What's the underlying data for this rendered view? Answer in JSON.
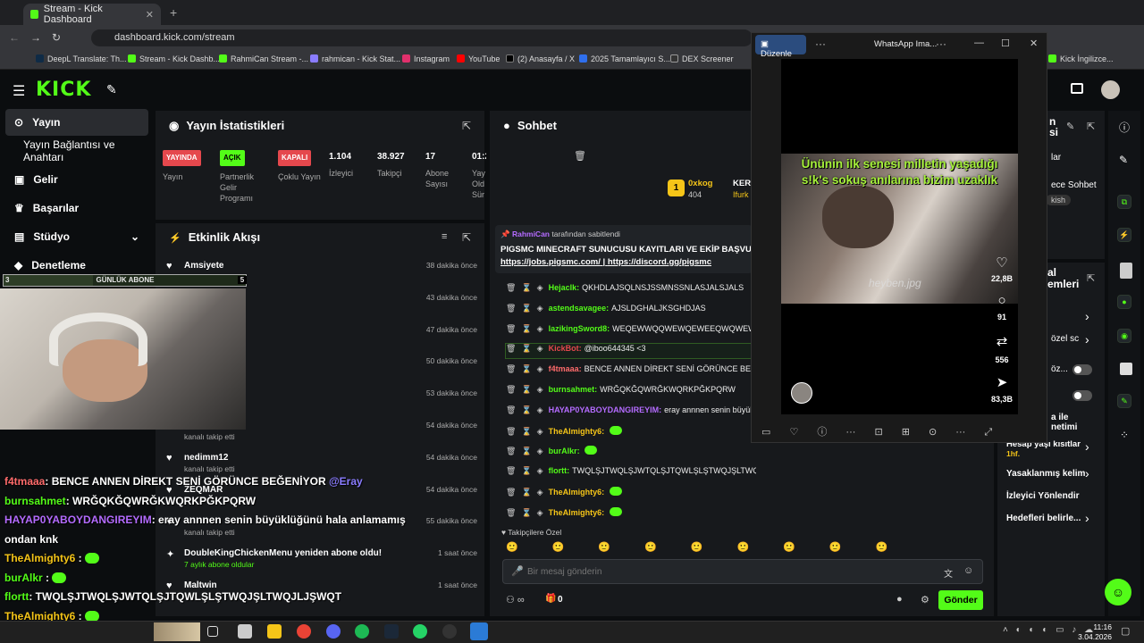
{
  "browser": {
    "tab_title": "Stream - Kick Dashboard",
    "url": "dashboard.kick.com/stream",
    "bookmarks": [
      "DeepL Translate: Th...",
      "Stream - Kick Dashb...",
      "RahmiCan Stream -...",
      "rahmican - Kick Stat...",
      "Instagram",
      "YouTube",
      "(2) Anasayfa / X",
      "2025 Tamamlayıcı S...",
      "DEX Screener",
      "Kick İngilizce..."
    ]
  },
  "sidebar": {
    "items": [
      "Yayın",
      "Yayın Bağlantısı ve Anahtarı",
      "Gelir",
      "Başarılar",
      "Stüdyo",
      "Denetleme"
    ]
  },
  "stats": {
    "title": "Yayın İstatistikleri",
    "status": [
      {
        "badge": "YAYINDA",
        "label": "Yayın"
      },
      {
        "badge": "AÇIK",
        "label": "Partnerlik Gelir Programı"
      },
      {
        "badge": "KAPALI",
        "label": "Çoklu Yayın"
      }
    ],
    "numbers": [
      {
        "value": "1.104",
        "label": "İzleyici"
      },
      {
        "value": "38.927",
        "label": "Takipçi"
      },
      {
        "value": "17",
        "label": "Abone Sayısı"
      },
      {
        "value": "01:2",
        "label": "Yay Old Sür"
      }
    ]
  },
  "activity": {
    "title": "Etkinlik Akışı",
    "events": [
      {
        "name": "Amsiyete",
        "sub": "kanalı takip etti",
        "time": "38 dakika önce",
        "icon": "heart"
      },
      {
        "name": "",
        "sub": "",
        "time": "43 dakika önce",
        "icon": "heart"
      },
      {
        "name": "",
        "sub": "",
        "time": "47 dakika önce",
        "icon": "heart"
      },
      {
        "name": "",
        "sub": "",
        "time": "50 dakika önce",
        "icon": "heart"
      },
      {
        "name": "",
        "sub": "",
        "time": "53 dakika önce",
        "icon": "heart"
      },
      {
        "name": "",
        "sub": "kanalı takip etti",
        "time": "54 dakika önce",
        "icon": "heart"
      },
      {
        "name": "nedimm12",
        "sub": "kanalı takip etti",
        "time": "54 dakika önce",
        "icon": "heart"
      },
      {
        "name": "ZEQMAR",
        "sub": "",
        "time": "54 dakika önce",
        "icon": "heart"
      },
      {
        "name": "",
        "sub": "kanalı takip etti",
        "time": "55 dakika önce",
        "icon": "heart"
      },
      {
        "name": "DoubleKingChickenMenu yeniden abone oldu!",
        "sub": "7 aylık abone oldular",
        "time": "1 saat önce",
        "icon": "star"
      },
      {
        "name": "Maltwin",
        "sub": "",
        "time": "1 saat önce",
        "icon": "heart"
      }
    ]
  },
  "chat": {
    "title": "Sohbet",
    "top_user": "0xkog",
    "top_count": "404",
    "top_right": "KER",
    "top_right2": "Ifurk",
    "pinned": {
      "by": "RahmiCan",
      "by_suffix": "tarafından sabitlendi",
      "text": "PIGSMC MINECRAFT SUNUCUSU KAYITLARI VE EKİP BAŞVUR",
      "link1": "https://jobs.pigsmc.com/",
      "sep": "|",
      "link2": "https://discord.gg/pigsmc"
    },
    "messages": [
      {
        "user": "Hejaclk:",
        "text": "QKHDLAJSQLNSJSSMNSSNLASJALSJALS",
        "color": "#53fc18"
      },
      {
        "user": "astendsavagee:",
        "text": "AJSLDGHALJKSGHDJAS",
        "color": "#53fc18"
      },
      {
        "user": "lazikingSword8:",
        "text": "WEQEWWQQWEWQEWEEQWQWEWEQ",
        "color": "#53fc18"
      },
      {
        "user": "KickBot:",
        "text": "@iboo644345 <3",
        "color": "#e5484d"
      },
      {
        "user": "f4tmaaa:",
        "text": "BENCE ANNEN DİREKT SENİ GÖRÜNCE BEĞEN",
        "color": "#ff6b6b"
      },
      {
        "user": "burnsahmet:",
        "text": "WRĞQKĞQWRĞKWQRKPĞKPQRW",
        "color": "#53fc18"
      },
      {
        "user": "HAYAP0YABOYDANGIREYIM:",
        "text": "eray annnen senin büyüklü",
        "color": "#b46bff"
      },
      {
        "user": "TheAlmighty6:",
        "text": "",
        "color": "#f5c518"
      },
      {
        "user": "burAlkr:",
        "text": "",
        "color": "#53fc18"
      },
      {
        "user": "flortt:",
        "text": "TWQLŞJTWQLŞJWTQLŞJTQWLŞLŞTWQJŞLTWQJLJŞWQT",
        "color": "#53fc18"
      },
      {
        "user": "TheAlmighty6:",
        "text": "",
        "color": "#f5c518"
      },
      {
        "user": "TheAlmighty6:",
        "text": "",
        "color": "#f5c518"
      }
    ],
    "followers_only": "Takipçilere Özel",
    "placeholder": "Bir mesaj gönderin",
    "send": "Gönder",
    "count": "0"
  },
  "overlay": {
    "sub_bar": "GÜNLÜK ABONE",
    "sub_left": "3",
    "sub_right": "5",
    "lines": [
      {
        "user": "f4tmaaa",
        "text": ": BENCE ANNEN DİREKT SENİ GÖRÜNCE BEĞENİYOR",
        "mention": "@Eray",
        "color": "#ff6b6b"
      },
      {
        "user": "burnsahmet",
        "text": ": WRĞQKĞQWRĞKWQRKPĞKPQRW",
        "color": "#53fc18"
      },
      {
        "user": "HAYAP0YABOYDANGIREYIM",
        "text": ": eray annnen senin büyüklüğünü hala anlamamış",
        "color": "#b46bff"
      },
      {
        "user": "",
        "text": "ondan knk",
        "color": "#fff"
      },
      {
        "user": "TheAlmighty6",
        "text": " :",
        "color": "#f5c518"
      },
      {
        "user": "burAlkr",
        "text": " :",
        "color": "#53fc18"
      },
      {
        "user": "flortt",
        "text": ": TWQLŞJTWQLŞJWTQLŞJTQWLŞLŞTWQJŞLTWQJLJŞWQT",
        "color": "#53fc18"
      },
      {
        "user": "TheAlmighty6",
        "text": " :",
        "color": "#f5c518"
      }
    ]
  },
  "whatsapp": {
    "edit": "Düzenle",
    "title": "WhatsApp Ima...",
    "caption1": "Ününin ilk senesi milletin yaşadığı",
    "caption2": "s!k's sokuş anılarına bizim uzaklık",
    "watermark": "heyben.jpg",
    "likes": "22,8B",
    "comments": "91",
    "reposts": "556",
    "shares": "83,3B"
  },
  "right": {
    "partial1": "n",
    "partial2": "si",
    "partial3": "lar",
    "partial4": "ece Sohbet",
    "chip": "kish",
    "partial5": "al",
    "partial6": "emleri",
    "partial7": "özel sc",
    "partial8": "öz...",
    "partial9": "a ile",
    "partial10": "netimi",
    "age_label": "Hesap yaşı kısıtlar",
    "age_val": "1hf.",
    "banned": "Yasaklanmış kelim",
    "redirect": "İzleyici Yönlendir",
    "goals": "Hedefleri belirle..."
  },
  "taskbar": {
    "time": "11:16",
    "date": "3.04.2026"
  }
}
